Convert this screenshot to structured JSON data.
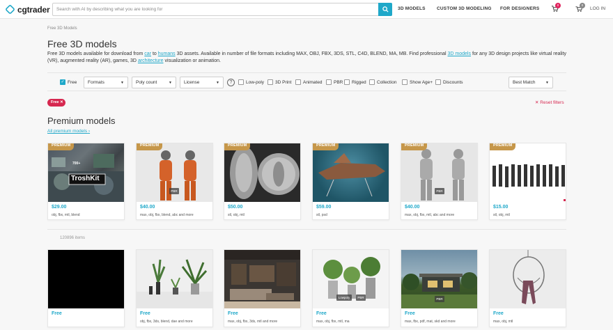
{
  "header": {
    "logo_text": "cgtrader",
    "search_placeholder": "Search with AI by describing what you are looking for",
    "nav": [
      "3D MODELS",
      "CUSTOM 3D MODELING",
      "FOR DESIGNERS"
    ],
    "cart_badge": "0",
    "notifications_badge": "0",
    "login": "LOG IN"
  },
  "breadcrumb": "Free 3D Models",
  "page_title": "Free 3D models",
  "description": {
    "p1": "Free 3D models available for download from ",
    "link_car": "car",
    "p2": " to ",
    "link_humans": "humans",
    "p3": " 3D assets. Available in number of file formats including MAX, OBJ, FBX, 3DS, STL, C4D, BLEND, MA, MB. Find professional ",
    "link_3dmodels": "3D models",
    "p4": " for any 3D design projects like virtual reality (VR), augmented reality (AR), games, 3D ",
    "link_architecture": "architecture",
    "p5": " visualization or animation."
  },
  "filters": {
    "free_label": "Free",
    "formats": "Formats",
    "poly_count": "Poly count",
    "license": "License",
    "help": "?",
    "checkboxes": [
      "Low-poly",
      "3D Print",
      "Animated",
      "PBR",
      "Rigged",
      "Collection",
      "Show Age+",
      "Discounts"
    ],
    "sort": "Best Match"
  },
  "active_chip": "Free",
  "reset_filters": "Reset filters",
  "premium_section": {
    "title": "Premium models",
    "link": "All premium models",
    "tag": "PREMIUM",
    "cards": [
      {
        "price": "$29.00",
        "formats": "obj, fbx, mtl, blend"
      },
      {
        "price": "$40.00",
        "formats": "max, obj, fbx, blend, abc and more"
      },
      {
        "price": "$50.00",
        "formats": "stl, obj, mtl"
      },
      {
        "price": "$59.00",
        "formats": "stl, psd"
      },
      {
        "price": "$40.00",
        "formats": "max, obj, fbx, mtl, abc and more"
      },
      {
        "price": "$15.00",
        "formats": "stl, obj, mtl"
      }
    ]
  },
  "items_count": "120896 items",
  "free_cards": [
    {
      "price": "Free",
      "formats": ""
    },
    {
      "price": "Free",
      "formats": "obj, fbx, 3ds, blend, dae and more"
    },
    {
      "price": "Free",
      "formats": "max, obj, fbx, 3ds, mtl and more"
    },
    {
      "price": "Free",
      "formats": "max, obj, fbx, mtl, ma"
    },
    {
      "price": "Free",
      "formats": "max, fbx, pdf, mat, skd and more"
    },
    {
      "price": "Free",
      "formats": "max, obj, mtl"
    }
  ],
  "thumb_labels": {
    "pbr": "PBR",
    "lowpoly": "Lowpoly",
    "troshkit": "TroshKit",
    "count": "700+"
  },
  "colors": {
    "accent": "#1fa8c9",
    "premium": "#c6974a",
    "danger": "#d62850"
  }
}
